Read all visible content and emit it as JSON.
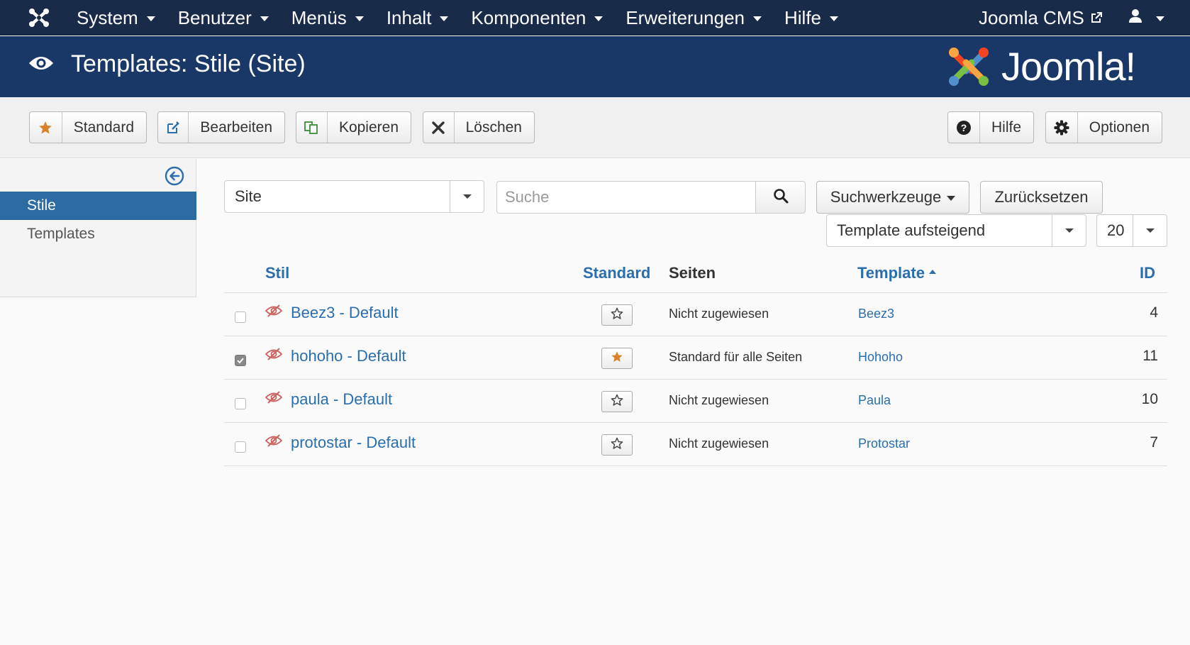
{
  "navbar": {
    "menu": [
      {
        "label": "System"
      },
      {
        "label": "Benutzer"
      },
      {
        "label": "Menüs"
      },
      {
        "label": "Inhalt"
      },
      {
        "label": "Komponenten"
      },
      {
        "label": "Erweiterungen"
      },
      {
        "label": "Hilfe"
      }
    ],
    "site_link": "Joomla CMS",
    "icons": [
      "joomla-logo-icon",
      "external-link-icon",
      "user-icon"
    ]
  },
  "header": {
    "title": "Templates: Stile (Site)",
    "brand": "Joomla!",
    "icons": [
      "eye-icon",
      "joomla-brand-logo"
    ]
  },
  "toolbar": {
    "standard": "Standard",
    "edit": "Bearbeiten",
    "copy": "Kopieren",
    "delete": "Löschen",
    "help": "Hilfe",
    "options": "Optionen",
    "icons": [
      "star-icon",
      "edit-icon",
      "copy-icon",
      "close-icon",
      "question-icon",
      "gear-icon"
    ],
    "colors": {
      "star": "#d9822b",
      "edit": "#2a6ead",
      "copy": "#3a8e3a"
    }
  },
  "sidebar": {
    "items": [
      {
        "label": "Stile",
        "active": true
      },
      {
        "label": "Templates",
        "active": false
      }
    ]
  },
  "filters": {
    "client": "Site",
    "search_placeholder": "Suche",
    "search_tools": "Suchwerkzeuge",
    "reset": "Zurücksetzen",
    "ordering": "Template aufsteigend",
    "limit": "20"
  },
  "table": {
    "headers": {
      "style": "Stil",
      "standard": "Standard",
      "pages": "Seiten",
      "template": "Template",
      "id": "ID"
    },
    "rows": [
      {
        "style": "Beez3 - Default",
        "home": false,
        "pages": "Nicht zugewiesen",
        "template": "Beez3",
        "id": "4",
        "checked": false
      },
      {
        "style": "hohoho - Default",
        "home": true,
        "pages": "Standard für alle Seiten",
        "template": "Hohoho",
        "id": "11",
        "checked": true
      },
      {
        "style": "paula - Default",
        "home": false,
        "pages": "Nicht zugewiesen",
        "template": "Paula",
        "id": "10",
        "checked": false
      },
      {
        "style": "protostar - Default",
        "home": false,
        "pages": "Nicht zugewiesen",
        "template": "Protostar",
        "id": "7",
        "checked": false
      }
    ]
  },
  "colors": {
    "navbar": "#182b48",
    "header": "#1a3867",
    "link": "#2a6ead",
    "sidebar_active": "#2d6ca2",
    "unpublished_icon": "#c9625d"
  }
}
